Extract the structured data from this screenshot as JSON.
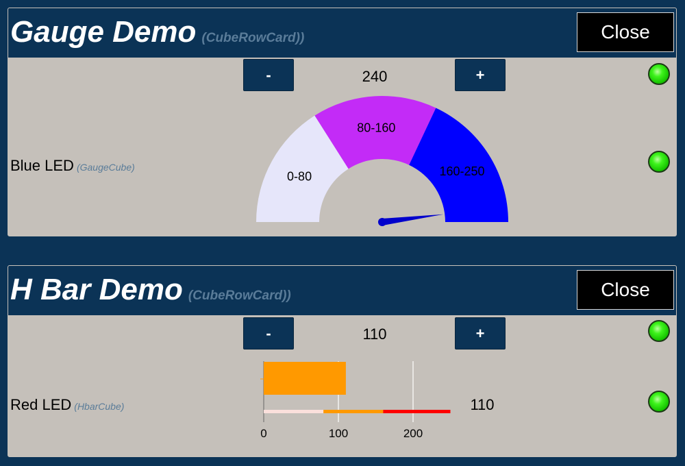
{
  "gauge_card": {
    "title": "Gauge Demo",
    "subtitle": "(CubeRowCard))",
    "close_label": "Close",
    "minus_label": "-",
    "plus_label": "+",
    "value": "240",
    "row_label": "Blue LED",
    "cube_name": "(GaugeCube)",
    "bands": [
      {
        "label": "0-80",
        "from": 0,
        "to": 80,
        "color": "#e6e6fa"
      },
      {
        "label": "80-160",
        "from": 80,
        "to": 160,
        "color": "#c32bf7"
      },
      {
        "label": "160-250",
        "from": 160,
        "to": 250,
        "color": "#0000ff"
      }
    ],
    "gauge_min": 0,
    "gauge_max": 250,
    "needle_value": 240,
    "needle_color": "#0000cc"
  },
  "hbar_card": {
    "title": "H Bar Demo",
    "subtitle": "(CubeRowCard))",
    "close_label": "Close",
    "minus_label": "-",
    "plus_label": "+",
    "value": "110",
    "row_label": "Red LED",
    "cube_name": "(HbarCube)",
    "bar_value": 110,
    "bar_color": "#ff9900",
    "value_display": "110",
    "axis_ticks": [
      "0",
      "100",
      "200"
    ],
    "range_bands": [
      {
        "from": 0,
        "to": 80,
        "color": "#fbe0dc"
      },
      {
        "from": 80,
        "to": 160,
        "color": "#ff9900"
      },
      {
        "from": 160,
        "to": 250,
        "color": "#ff0000"
      }
    ]
  },
  "chart_data": [
    {
      "type": "gauge",
      "title": "",
      "min": 0,
      "max": 250,
      "value": 240,
      "bands": [
        {
          "label": "0-80",
          "from": 0,
          "to": 80
        },
        {
          "label": "80-160",
          "from": 80,
          "to": 160
        },
        {
          "label": "160-250",
          "from": 160,
          "to": 250
        }
      ]
    },
    {
      "type": "bar",
      "orientation": "horizontal",
      "categories": [
        ""
      ],
      "values": [
        110
      ],
      "xlim": [
        0,
        250
      ],
      "x_ticks": [
        0,
        100,
        200
      ],
      "ranges": [
        [
          0,
          80
        ],
        [
          80,
          160
        ],
        [
          160,
          250
        ]
      ]
    }
  ],
  "colors": {
    "background": "#0b3356",
    "card_body": "#c5c0ba",
    "led_on": "#33ee11"
  }
}
